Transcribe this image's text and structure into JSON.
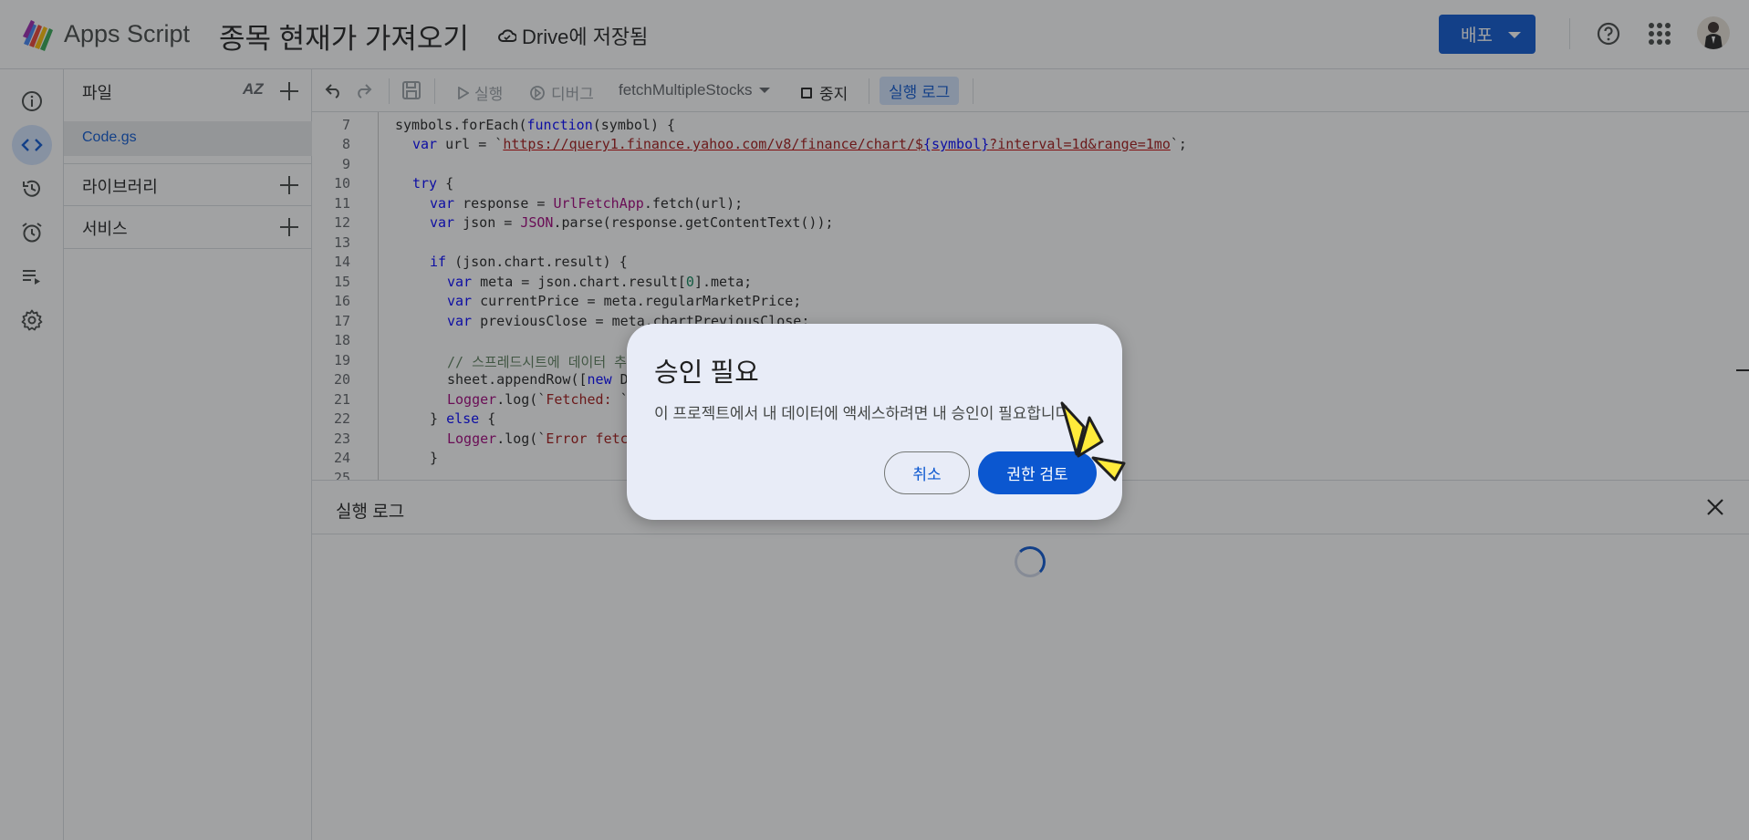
{
  "app": {
    "name": "Apps Script",
    "project_title": "종목 현재가 가져오기",
    "save_status": "Drive에 저장됨",
    "deploy_label": "배포"
  },
  "files_panel": {
    "title": "파일",
    "sort_label": "AZ",
    "files": [
      {
        "name": "Code.gs"
      }
    ],
    "libraries_label": "라이브러리",
    "services_label": "서비스"
  },
  "toolbar": {
    "run_label": "실행",
    "debug_label": "디버그",
    "function_name": "fetchMultipleStocks",
    "stop_label": "중지",
    "log_label": "실행 로그"
  },
  "editor": {
    "line_numbers": [
      "7",
      "8",
      "9",
      "10",
      "11",
      "12",
      "13",
      "14",
      "15",
      "16",
      "17",
      "18",
      "19",
      "20",
      "21",
      "22",
      "23",
      "24",
      "25"
    ]
  },
  "log_panel": {
    "title": "실행 로그"
  },
  "dialog": {
    "title": "승인 필요",
    "message": "이 프로젝트에서 내 데이터에 액세스하려면 내 승인이 필요합니다.",
    "cancel_label": "취소",
    "review_label": "권한 검토"
  },
  "colors": {
    "accent": "#0b57d0",
    "accent_light": "#d3e3fd",
    "dialog_bg": "#e8ecf7",
    "pointer": "#ffeb3b"
  },
  "icons": {
    "rail": [
      "info-icon",
      "code-icon",
      "history-icon",
      "alarm-icon",
      "executions-icon",
      "gear-icon"
    ]
  }
}
